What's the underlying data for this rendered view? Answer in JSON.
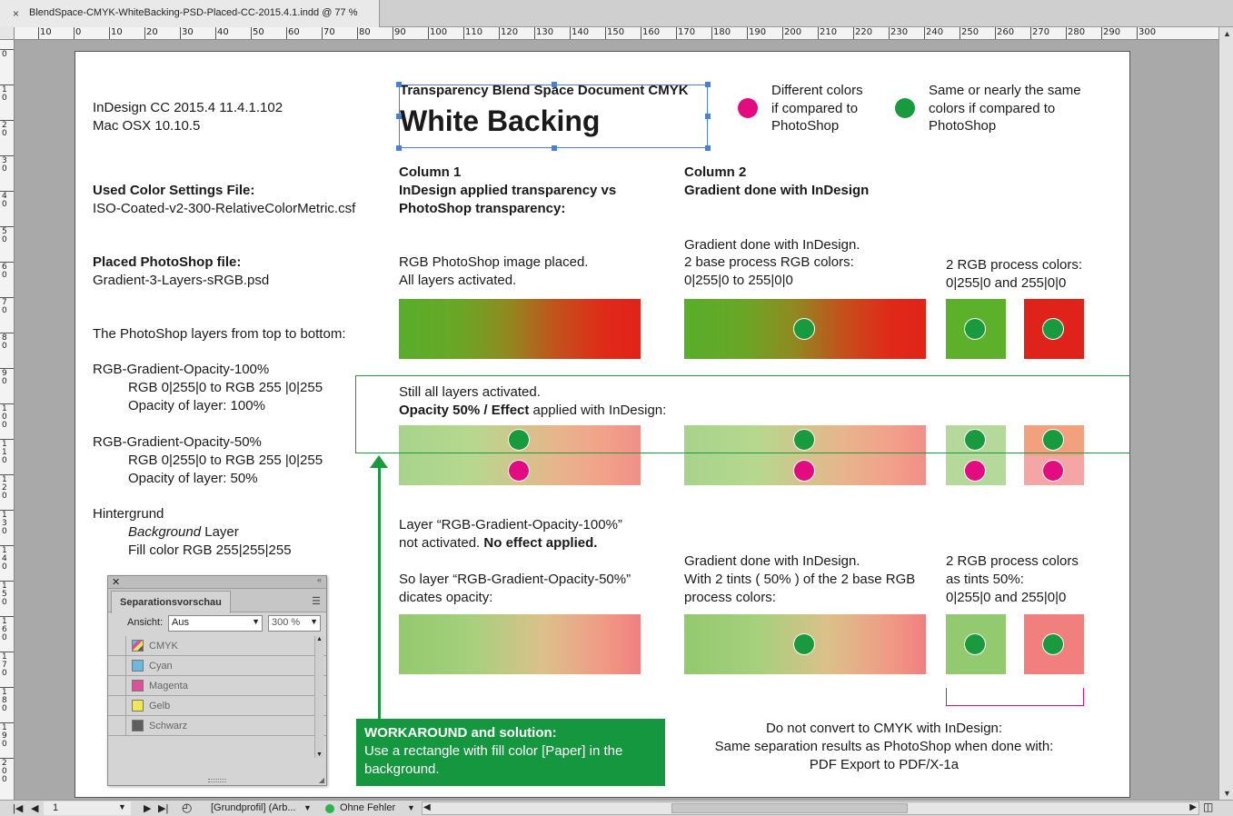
{
  "window": {
    "tab_title": "BlendSpace-CMYK-WhiteBacking-PSD-Placed-CC-2015.4.1.indd @ 77 %",
    "close_glyph": "×"
  },
  "ruler": {
    "h_labels": [
      "10",
      "0",
      "10",
      "20",
      "30",
      "40",
      "50",
      "60",
      "70",
      "80",
      "90",
      "100",
      "110",
      "120",
      "130",
      "140",
      "150",
      "160",
      "170",
      "180",
      "190",
      "200",
      "210",
      "220",
      "230",
      "240",
      "250",
      "260",
      "270",
      "280",
      "290",
      "300"
    ],
    "v_labels": [
      "0",
      "10",
      "20",
      "30",
      "40",
      "50",
      "60",
      "70",
      "80",
      "90",
      "100",
      "110",
      "120",
      "130",
      "140",
      "150",
      "160",
      "170",
      "180",
      "190",
      "200"
    ]
  },
  "doc": {
    "app_info": [
      "InDesign CC 2015.4 11.4.1.102",
      "Mac OSX 10.10.5"
    ],
    "settings_title": "Used Color Settings File:",
    "settings_value": "ISO-Coated-v2-300-RelativeColorMetric.csf",
    "placed_title": "Placed PhotoShop file:",
    "placed_value": "Gradient-3-Layers-sRGB.psd",
    "layers_intro": "The PhotoShop layers from top to bottom:",
    "layer1_name": "RGB-Gradient-Opacity-100%",
    "layer1_line1": "RGB 0|255|0 to RGB 255 |0|255",
    "layer1_line2": "Opacity of layer: 100%",
    "layer2_name": "RGB-Gradient-Opacity-50%",
    "layer2_line1": "RGB 0|255|0 to RGB 255 |0|255",
    "layer2_line2": "Opacity of layer: 50%",
    "bg_name": "Hintergrund",
    "bg_line1_italic": "Background",
    "bg_line1_rest": " Layer",
    "bg_line2": "Fill color RGB 255|255|255",
    "header_small": "Transparency Blend Space Document CMYK",
    "header_big": "White Backing",
    "legend_diff": [
      "Different colors",
      "if compared to",
      "PhotoShop"
    ],
    "legend_same": [
      "Same or nearly the same",
      "colors if compared to",
      "PhotoShop"
    ],
    "col1_title": [
      "Column 1",
      "InDesign applied transparency vs",
      "PhotoShop transparency:"
    ],
    "col2_title": [
      "Column 2",
      "Gradient done with InDesign"
    ],
    "row1_col1": [
      "RGB PhotoShop image placed.",
      "All layers activated."
    ],
    "row1_col2": [
      "Gradient done with InDesign.",
      "2 base process RGB colors:",
      "0|255|0 to 255|0|0"
    ],
    "row1_col3": [
      "2 RGB process colors:",
      "0|255|0 and 255|0|0"
    ],
    "row2_line1": "Still all layers activated.",
    "row2_line2_bold": "Opacity 50% / Effect",
    "row2_line2_rest": " applied with InDesign:",
    "row3_line1": "Layer “RGB-Gradient-Opacity-100%”",
    "row3_line2_plain": "not activated. ",
    "row3_line2_bold": "No effect applied.",
    "row3_line3": "So layer “RGB-Gradient-Opacity-50%”",
    "row3_line4": "dicates opacity:",
    "row3_col2": [
      "Gradient done with InDesign.",
      "With 2 tints ( 50% ) of the 2 base RGB",
      "process colors:"
    ],
    "row3_col3": [
      "2 RGB process colors",
      "as tints 50%:",
      "0|255|0 and 255|0|0"
    ],
    "workaround_title": "WORKAROUND and solution:",
    "workaround_text": [
      "Use a rectangle with fill color [Paper] in the",
      "background."
    ],
    "note": [
      "Do not convert to CMYK with InDesign:",
      "Same separation results as PhotoShop when done with:",
      "PDF Export to PDF/X-1a"
    ]
  },
  "colors": {
    "green_dot": "#1a9a3e",
    "magenta_dot": "#e20b7f",
    "rgb_green": "#5cb02a",
    "rgb_red": "#e0231a",
    "tint_green": "#93c96f",
    "tint_red": "#f07f7d"
  },
  "separations": {
    "tab": "Separationsvorschau",
    "view_label": "Ansicht:",
    "view_value": "Aus",
    "zoom_value": "300 %",
    "inks": [
      {
        "name": "CMYK",
        "swatch": "cmyk"
      },
      {
        "name": "Cyan",
        "swatch": "#6fb8dd"
      },
      {
        "name": "Magenta",
        "swatch": "#d9529a"
      },
      {
        "name": "Gelb",
        "swatch": "#efe65a"
      },
      {
        "name": "Schwarz",
        "swatch": "#5e5e5e"
      }
    ]
  },
  "status": {
    "page_number": "1",
    "profile": "[Grundprofil] (Arb...",
    "preflight": "Ohne Fehler"
  }
}
